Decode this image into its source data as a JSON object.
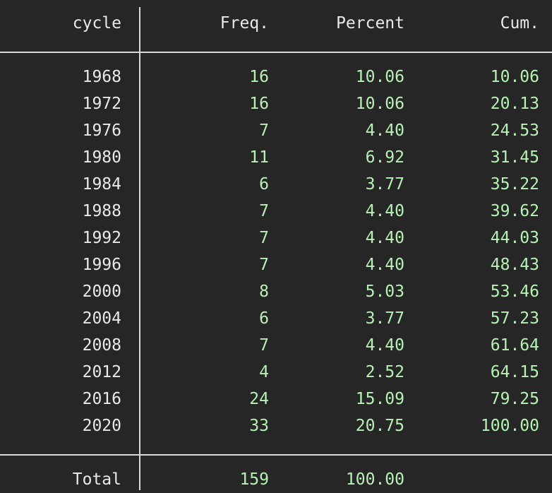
{
  "table": {
    "headers": {
      "var": "cycle",
      "freq": "Freq.",
      "percent": "Percent",
      "cum": "Cum."
    },
    "rows": [
      {
        "cycle": "1968",
        "freq": "16",
        "percent": "10.06",
        "cum": "10.06"
      },
      {
        "cycle": "1972",
        "freq": "16",
        "percent": "10.06",
        "cum": "20.13"
      },
      {
        "cycle": "1976",
        "freq": "7",
        "percent": "4.40",
        "cum": "24.53"
      },
      {
        "cycle": "1980",
        "freq": "11",
        "percent": "6.92",
        "cum": "31.45"
      },
      {
        "cycle": "1984",
        "freq": "6",
        "percent": "3.77",
        "cum": "35.22"
      },
      {
        "cycle": "1988",
        "freq": "7",
        "percent": "4.40",
        "cum": "39.62"
      },
      {
        "cycle": "1992",
        "freq": "7",
        "percent": "4.40",
        "cum": "44.03"
      },
      {
        "cycle": "1996",
        "freq": "7",
        "percent": "4.40",
        "cum": "48.43"
      },
      {
        "cycle": "2000",
        "freq": "8",
        "percent": "5.03",
        "cum": "53.46"
      },
      {
        "cycle": "2004",
        "freq": "6",
        "percent": "3.77",
        "cum": "57.23"
      },
      {
        "cycle": "2008",
        "freq": "7",
        "percent": "4.40",
        "cum": "61.64"
      },
      {
        "cycle": "2012",
        "freq": "4",
        "percent": "2.52",
        "cum": "64.15"
      },
      {
        "cycle": "2016",
        "freq": "24",
        "percent": "15.09",
        "cum": "79.25"
      },
      {
        "cycle": "2020",
        "freq": "33",
        "percent": "20.75",
        "cum": "100.00"
      }
    ],
    "total": {
      "label": "Total",
      "freq": "159",
      "percent": "100.00"
    }
  },
  "colors": {
    "background": "#262626",
    "label_text": "#e9e9e9",
    "value_text": "#b7f2b4",
    "rule": "#d9d9d9"
  }
}
